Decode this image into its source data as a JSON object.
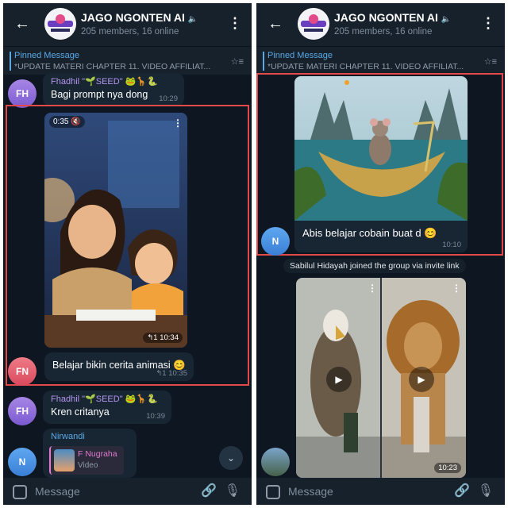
{
  "left": {
    "header": {
      "back_icon": "←",
      "title": "JAGO NGONTEN AI",
      "subtitle": "205 members, 16 online",
      "menu_icon": "⋮"
    },
    "pinned": {
      "label": "Pinned Message",
      "text": "*UPDATE MATERI CHAPTER 11. VIDEO AFFILIAT..."
    },
    "messages": [
      {
        "avatar": "FH",
        "sender": "Fhadhil \"🌱SEED\" 🐸🦒🐍",
        "text": "Bagi prompt nya dong",
        "time": "10:29"
      },
      {
        "video_duration": "0:35",
        "video_time": "10:34"
      },
      {
        "avatar": "FN",
        "text": "Belajar bikin cerita animasi 😊",
        "time": "10:35"
      },
      {
        "avatar": "FH",
        "sender": "Fhadhil \"🌱SEED\" 🐸🦒🐍",
        "text": "Kren critanya",
        "time": "10:39"
      },
      {
        "avatar": "N",
        "sender": "Nirwandi",
        "reply_name": "F Nugraha",
        "reply_type": "Video"
      }
    ],
    "composer": {
      "placeholder": "Message"
    }
  },
  "right": {
    "header": {
      "back_icon": "←",
      "title": "JAGO NGONTEN AI",
      "subtitle": "205 members, 16 online",
      "menu_icon": "⋮"
    },
    "pinned": {
      "label": "Pinned Message",
      "text": "*UPDATE MATERI CHAPTER 11. VIDEO AFFILIAT..."
    },
    "messages": [
      {
        "avatar": "N",
        "text": "Abis belajar cobain buat d 😊",
        "time": "10:10"
      },
      {
        "service": "Sabilul Hidayah joined the group via invite link"
      },
      {
        "video_time": "10:23"
      }
    ],
    "composer": {
      "placeholder": "Message"
    }
  }
}
